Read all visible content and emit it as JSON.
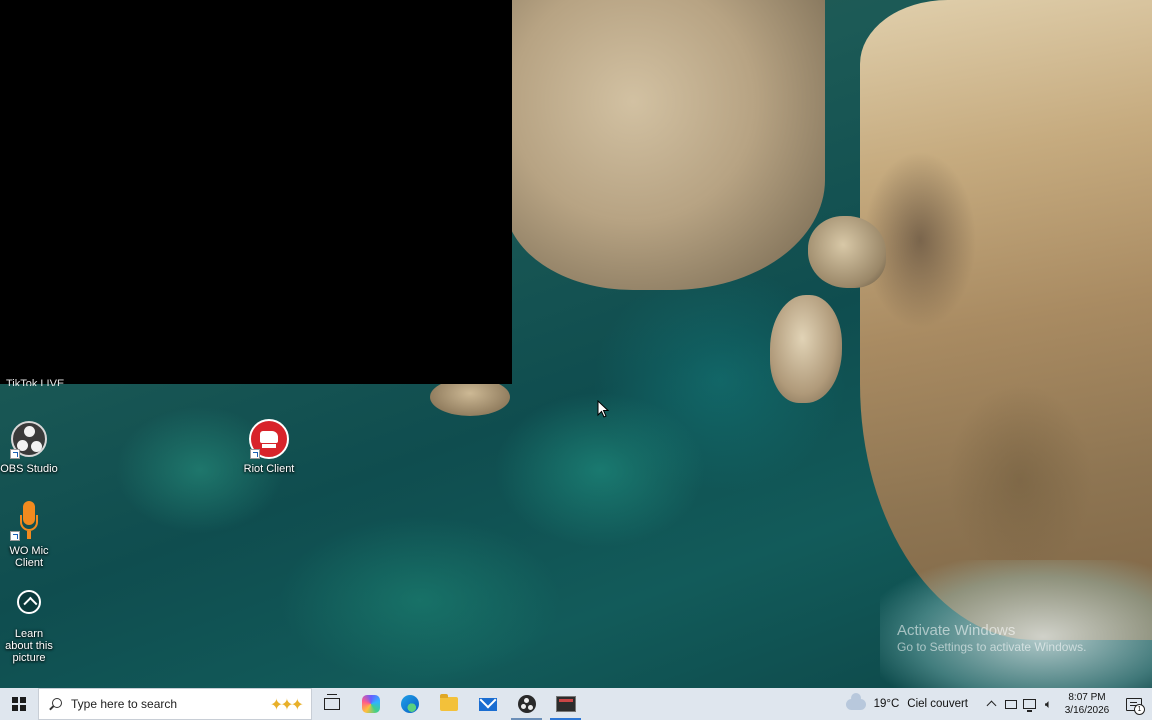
{
  "desktop": {
    "hidden_icon_label": "TikTok LIVE",
    "icons": [
      {
        "label": "OBS Studio",
        "icon": "obs-icon"
      },
      {
        "label": "Riot Client",
        "icon": "riot-client-icon"
      },
      {
        "label": "WO Mic Client",
        "icon": "microphone-icon"
      },
      {
        "label": "Learn about this picture",
        "icon": "learn-picture-icon"
      }
    ],
    "watermark": {
      "line1": "Activate Windows",
      "line2": "Go to Settings to activate Windows."
    }
  },
  "taskbar": {
    "search_placeholder": "Type here to search",
    "pinned": [
      {
        "name": "Task View",
        "icon": "task-view-icon"
      },
      {
        "name": "Copilot",
        "icon": "copilot-icon"
      },
      {
        "name": "Microsoft Edge",
        "icon": "edge-icon"
      },
      {
        "name": "File Explorer",
        "icon": "folder-icon"
      },
      {
        "name": "Mail",
        "icon": "mail-icon"
      },
      {
        "name": "OBS Studio",
        "icon": "obs-icon"
      },
      {
        "name": "Active window",
        "icon": "window-icon"
      }
    ],
    "weather": {
      "temp": "19°C",
      "condition": "Ciel couvert"
    },
    "clock": {
      "time": "8:07 PM",
      "date": "3/16/2026"
    },
    "notification_count": "1"
  }
}
